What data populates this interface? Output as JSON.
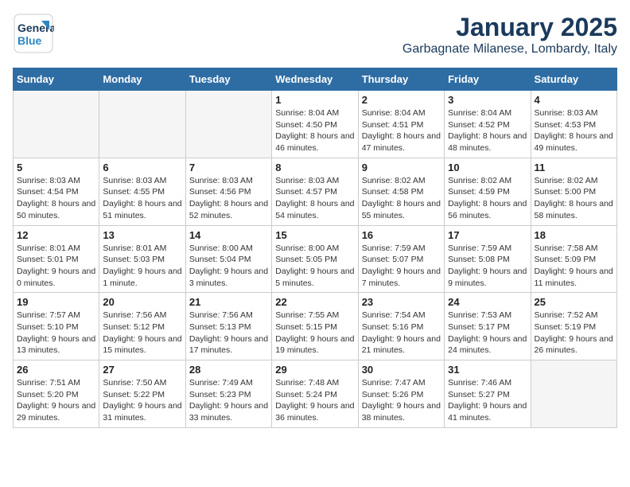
{
  "header": {
    "logo_line1": "General",
    "logo_line2": "Blue",
    "title": "January 2025",
    "subtitle": "Garbagnate Milanese, Lombardy, Italy"
  },
  "days_of_week": [
    "Sunday",
    "Monday",
    "Tuesday",
    "Wednesday",
    "Thursday",
    "Friday",
    "Saturday"
  ],
  "weeks": [
    [
      {
        "day": "",
        "empty": true
      },
      {
        "day": "",
        "empty": true
      },
      {
        "day": "",
        "empty": true
      },
      {
        "day": "1",
        "sunrise": "8:04 AM",
        "sunset": "4:50 PM",
        "daylight": "8 hours and 46 minutes."
      },
      {
        "day": "2",
        "sunrise": "8:04 AM",
        "sunset": "4:51 PM",
        "daylight": "8 hours and 47 minutes."
      },
      {
        "day": "3",
        "sunrise": "8:04 AM",
        "sunset": "4:52 PM",
        "daylight": "8 hours and 48 minutes."
      },
      {
        "day": "4",
        "sunrise": "8:03 AM",
        "sunset": "4:53 PM",
        "daylight": "8 hours and 49 minutes."
      }
    ],
    [
      {
        "day": "5",
        "sunrise": "8:03 AM",
        "sunset": "4:54 PM",
        "daylight": "8 hours and 50 minutes."
      },
      {
        "day": "6",
        "sunrise": "8:03 AM",
        "sunset": "4:55 PM",
        "daylight": "8 hours and 51 minutes."
      },
      {
        "day": "7",
        "sunrise": "8:03 AM",
        "sunset": "4:56 PM",
        "daylight": "8 hours and 52 minutes."
      },
      {
        "day": "8",
        "sunrise": "8:03 AM",
        "sunset": "4:57 PM",
        "daylight": "8 hours and 54 minutes."
      },
      {
        "day": "9",
        "sunrise": "8:02 AM",
        "sunset": "4:58 PM",
        "daylight": "8 hours and 55 minutes."
      },
      {
        "day": "10",
        "sunrise": "8:02 AM",
        "sunset": "4:59 PM",
        "daylight": "8 hours and 56 minutes."
      },
      {
        "day": "11",
        "sunrise": "8:02 AM",
        "sunset": "5:00 PM",
        "daylight": "8 hours and 58 minutes."
      }
    ],
    [
      {
        "day": "12",
        "sunrise": "8:01 AM",
        "sunset": "5:01 PM",
        "daylight": "9 hours and 0 minutes."
      },
      {
        "day": "13",
        "sunrise": "8:01 AM",
        "sunset": "5:03 PM",
        "daylight": "9 hours and 1 minute."
      },
      {
        "day": "14",
        "sunrise": "8:00 AM",
        "sunset": "5:04 PM",
        "daylight": "9 hours and 3 minutes."
      },
      {
        "day": "15",
        "sunrise": "8:00 AM",
        "sunset": "5:05 PM",
        "daylight": "9 hours and 5 minutes."
      },
      {
        "day": "16",
        "sunrise": "7:59 AM",
        "sunset": "5:07 PM",
        "daylight": "9 hours and 7 minutes."
      },
      {
        "day": "17",
        "sunrise": "7:59 AM",
        "sunset": "5:08 PM",
        "daylight": "9 hours and 9 minutes."
      },
      {
        "day": "18",
        "sunrise": "7:58 AM",
        "sunset": "5:09 PM",
        "daylight": "9 hours and 11 minutes."
      }
    ],
    [
      {
        "day": "19",
        "sunrise": "7:57 AM",
        "sunset": "5:10 PM",
        "daylight": "9 hours and 13 minutes."
      },
      {
        "day": "20",
        "sunrise": "7:56 AM",
        "sunset": "5:12 PM",
        "daylight": "9 hours and 15 minutes."
      },
      {
        "day": "21",
        "sunrise": "7:56 AM",
        "sunset": "5:13 PM",
        "daylight": "9 hours and 17 minutes."
      },
      {
        "day": "22",
        "sunrise": "7:55 AM",
        "sunset": "5:15 PM",
        "daylight": "9 hours and 19 minutes."
      },
      {
        "day": "23",
        "sunrise": "7:54 AM",
        "sunset": "5:16 PM",
        "daylight": "9 hours and 21 minutes."
      },
      {
        "day": "24",
        "sunrise": "7:53 AM",
        "sunset": "5:17 PM",
        "daylight": "9 hours and 24 minutes."
      },
      {
        "day": "25",
        "sunrise": "7:52 AM",
        "sunset": "5:19 PM",
        "daylight": "9 hours and 26 minutes."
      }
    ],
    [
      {
        "day": "26",
        "sunrise": "7:51 AM",
        "sunset": "5:20 PM",
        "daylight": "9 hours and 29 minutes."
      },
      {
        "day": "27",
        "sunrise": "7:50 AM",
        "sunset": "5:22 PM",
        "daylight": "9 hours and 31 minutes."
      },
      {
        "day": "28",
        "sunrise": "7:49 AM",
        "sunset": "5:23 PM",
        "daylight": "9 hours and 33 minutes."
      },
      {
        "day": "29",
        "sunrise": "7:48 AM",
        "sunset": "5:24 PM",
        "daylight": "9 hours and 36 minutes."
      },
      {
        "day": "30",
        "sunrise": "7:47 AM",
        "sunset": "5:26 PM",
        "daylight": "9 hours and 38 minutes."
      },
      {
        "day": "31",
        "sunrise": "7:46 AM",
        "sunset": "5:27 PM",
        "daylight": "9 hours and 41 minutes."
      },
      {
        "day": "",
        "empty": true
      }
    ]
  ]
}
